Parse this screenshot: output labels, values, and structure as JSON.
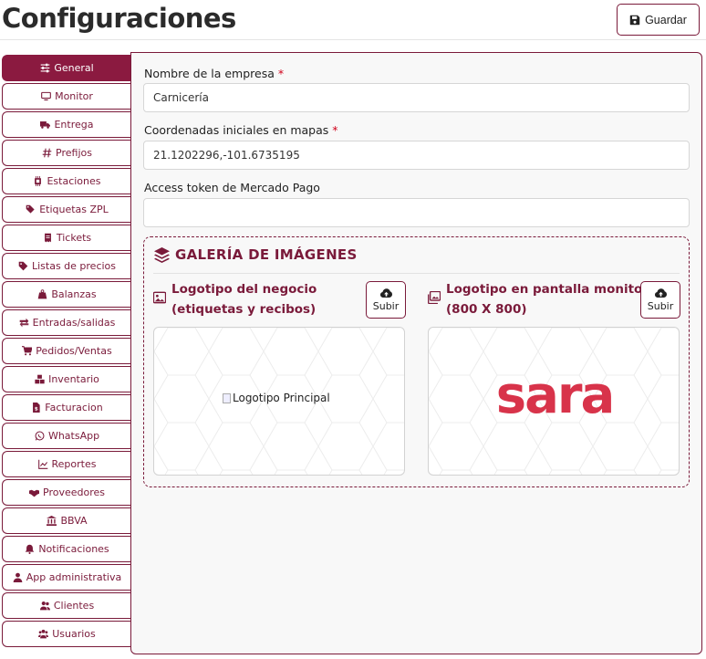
{
  "page": {
    "title": "Configuraciones"
  },
  "toolbar": {
    "save_label": "Guardar",
    "save_icon": "floppy-disk-icon"
  },
  "sidebar": {
    "items": [
      {
        "label": "General",
        "icon": "sliders-icon",
        "active": true
      },
      {
        "label": "Monitor",
        "icon": "monitor-icon"
      },
      {
        "label": "Entrega",
        "icon": "truck-icon"
      },
      {
        "label": "Prefijos",
        "icon": "hashtag-icon"
      },
      {
        "label": "Estaciones",
        "icon": "chip-icon"
      },
      {
        "label": "Etiquetas ZPL",
        "icon": "tags-icon"
      },
      {
        "label": "Tickets",
        "icon": "receipt-icon"
      },
      {
        "label": "Listas de precios",
        "icon": "tag-icon"
      },
      {
        "label": "Balanzas",
        "icon": "weight-icon"
      },
      {
        "label": "Entradas/salidas",
        "icon": "arrows-left-right-icon"
      },
      {
        "label": "Pedidos/Ventas",
        "icon": "cart-icon"
      },
      {
        "label": "Inventario",
        "icon": "boxes-icon"
      },
      {
        "label": "Facturacion",
        "icon": "invoice-icon"
      },
      {
        "label": "WhatsApp",
        "icon": "whatsapp-icon"
      },
      {
        "label": "Reportes",
        "icon": "chart-line-icon"
      },
      {
        "label": "Proveedores",
        "icon": "handshake-icon"
      },
      {
        "label": "BBVA",
        "icon": "bank-icon"
      },
      {
        "label": "Notificaciones",
        "icon": "bell-icon"
      },
      {
        "label": "App administrativa",
        "icon": "user-icon"
      },
      {
        "label": "Clientes",
        "icon": "users-icon"
      },
      {
        "label": "Usuarios",
        "icon": "users-gear-icon"
      }
    ]
  },
  "form": {
    "company_name": {
      "label": "Nombre de la empresa",
      "required_mark": "*",
      "value": "Carnicería"
    },
    "map_coords": {
      "label": "Coordenadas iniciales en mapas",
      "required_mark": "*",
      "value": "21.1202296,-101.6735195"
    },
    "mp_token": {
      "label": "Access token de Mercado Pago",
      "value": ""
    }
  },
  "gallery": {
    "title": "GALERÍA DE IMÁGENES",
    "business_logo": {
      "title_line1": "Logotipo del negocio",
      "title_line2": "(etiquetas y recibos)",
      "upload_label": "Subir",
      "image_alt": "Logotipo Principal"
    },
    "monitor_logo": {
      "title_line1": "Logotipo en pantalla monitor",
      "title_line2": "(800 X 800)",
      "upload_label": "Subir",
      "image_text": "sara"
    }
  },
  "colors": {
    "accent": "#8b1a40",
    "border_accent": "#7a1a3a",
    "required": "#d0021b",
    "logo_red": "#d8334a"
  }
}
